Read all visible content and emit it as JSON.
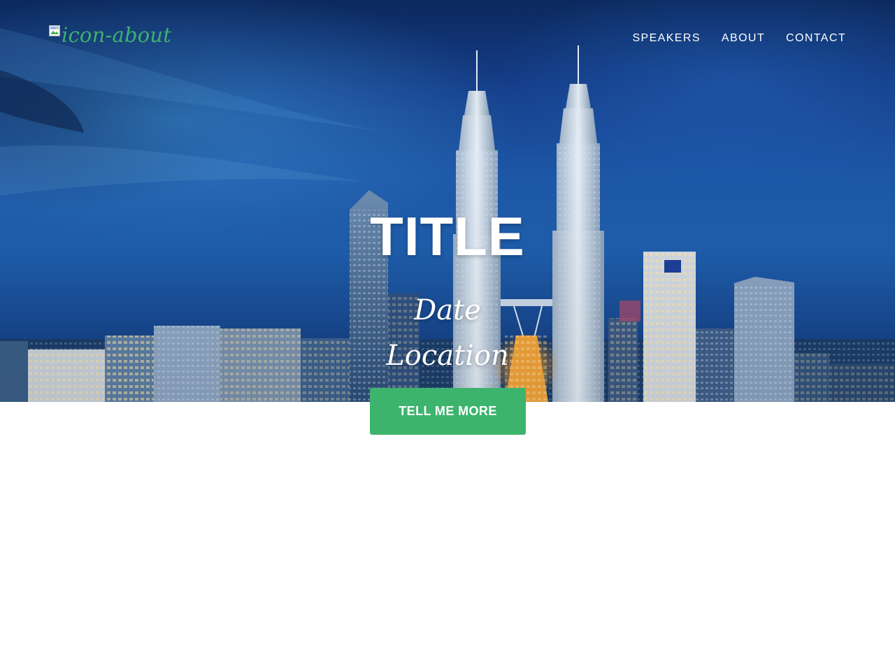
{
  "nav": {
    "brand_alt": "icon-about",
    "items": [
      {
        "label": "SPEAKERS"
      },
      {
        "label": "ABOUT"
      },
      {
        "label": "CONTACT"
      }
    ]
  },
  "hero": {
    "title": "TITLE",
    "date": "Date",
    "location": "Location",
    "cta_label": "TELL ME MORE"
  },
  "colors": {
    "accent": "#3db46d",
    "brand_text": "#3fb06e",
    "sky_top": "#0d2b63",
    "sky_mid": "#1d58a8",
    "text_light": "#ffffff",
    "page_background": "#ffffff"
  },
  "icons": {
    "broken_image": "broken-image-icon"
  }
}
